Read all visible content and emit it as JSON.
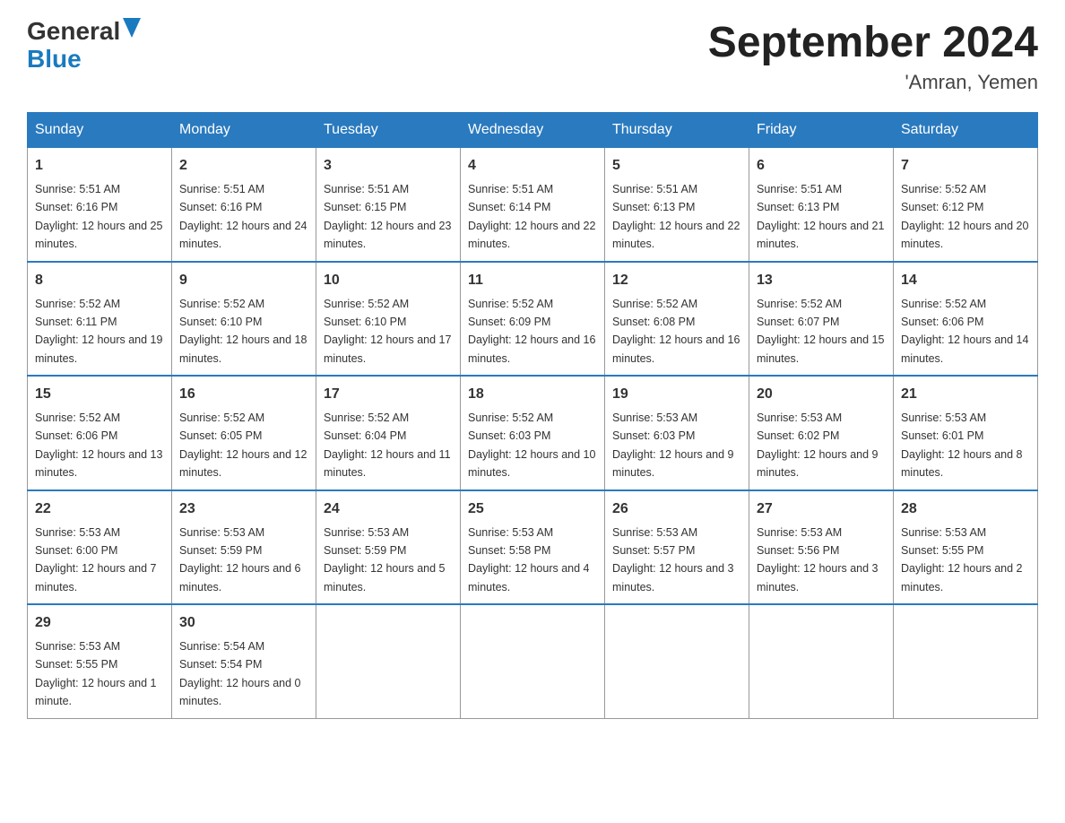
{
  "header": {
    "logo_general": "General",
    "logo_blue": "Blue",
    "month_title": "September 2024",
    "location": "'Amran, Yemen"
  },
  "days_of_week": [
    "Sunday",
    "Monday",
    "Tuesday",
    "Wednesday",
    "Thursday",
    "Friday",
    "Saturday"
  ],
  "weeks": [
    [
      {
        "day": "1",
        "sunrise": "Sunrise: 5:51 AM",
        "sunset": "Sunset: 6:16 PM",
        "daylight": "Daylight: 12 hours and 25 minutes."
      },
      {
        "day": "2",
        "sunrise": "Sunrise: 5:51 AM",
        "sunset": "Sunset: 6:16 PM",
        "daylight": "Daylight: 12 hours and 24 minutes."
      },
      {
        "day": "3",
        "sunrise": "Sunrise: 5:51 AM",
        "sunset": "Sunset: 6:15 PM",
        "daylight": "Daylight: 12 hours and 23 minutes."
      },
      {
        "day": "4",
        "sunrise": "Sunrise: 5:51 AM",
        "sunset": "Sunset: 6:14 PM",
        "daylight": "Daylight: 12 hours and 22 minutes."
      },
      {
        "day": "5",
        "sunrise": "Sunrise: 5:51 AM",
        "sunset": "Sunset: 6:13 PM",
        "daylight": "Daylight: 12 hours and 22 minutes."
      },
      {
        "day": "6",
        "sunrise": "Sunrise: 5:51 AM",
        "sunset": "Sunset: 6:13 PM",
        "daylight": "Daylight: 12 hours and 21 minutes."
      },
      {
        "day": "7",
        "sunrise": "Sunrise: 5:52 AM",
        "sunset": "Sunset: 6:12 PM",
        "daylight": "Daylight: 12 hours and 20 minutes."
      }
    ],
    [
      {
        "day": "8",
        "sunrise": "Sunrise: 5:52 AM",
        "sunset": "Sunset: 6:11 PM",
        "daylight": "Daylight: 12 hours and 19 minutes."
      },
      {
        "day": "9",
        "sunrise": "Sunrise: 5:52 AM",
        "sunset": "Sunset: 6:10 PM",
        "daylight": "Daylight: 12 hours and 18 minutes."
      },
      {
        "day": "10",
        "sunrise": "Sunrise: 5:52 AM",
        "sunset": "Sunset: 6:10 PM",
        "daylight": "Daylight: 12 hours and 17 minutes."
      },
      {
        "day": "11",
        "sunrise": "Sunrise: 5:52 AM",
        "sunset": "Sunset: 6:09 PM",
        "daylight": "Daylight: 12 hours and 16 minutes."
      },
      {
        "day": "12",
        "sunrise": "Sunrise: 5:52 AM",
        "sunset": "Sunset: 6:08 PM",
        "daylight": "Daylight: 12 hours and 16 minutes."
      },
      {
        "day": "13",
        "sunrise": "Sunrise: 5:52 AM",
        "sunset": "Sunset: 6:07 PM",
        "daylight": "Daylight: 12 hours and 15 minutes."
      },
      {
        "day": "14",
        "sunrise": "Sunrise: 5:52 AM",
        "sunset": "Sunset: 6:06 PM",
        "daylight": "Daylight: 12 hours and 14 minutes."
      }
    ],
    [
      {
        "day": "15",
        "sunrise": "Sunrise: 5:52 AM",
        "sunset": "Sunset: 6:06 PM",
        "daylight": "Daylight: 12 hours and 13 minutes."
      },
      {
        "day": "16",
        "sunrise": "Sunrise: 5:52 AM",
        "sunset": "Sunset: 6:05 PM",
        "daylight": "Daylight: 12 hours and 12 minutes."
      },
      {
        "day": "17",
        "sunrise": "Sunrise: 5:52 AM",
        "sunset": "Sunset: 6:04 PM",
        "daylight": "Daylight: 12 hours and 11 minutes."
      },
      {
        "day": "18",
        "sunrise": "Sunrise: 5:52 AM",
        "sunset": "Sunset: 6:03 PM",
        "daylight": "Daylight: 12 hours and 10 minutes."
      },
      {
        "day": "19",
        "sunrise": "Sunrise: 5:53 AM",
        "sunset": "Sunset: 6:03 PM",
        "daylight": "Daylight: 12 hours and 9 minutes."
      },
      {
        "day": "20",
        "sunrise": "Sunrise: 5:53 AM",
        "sunset": "Sunset: 6:02 PM",
        "daylight": "Daylight: 12 hours and 9 minutes."
      },
      {
        "day": "21",
        "sunrise": "Sunrise: 5:53 AM",
        "sunset": "Sunset: 6:01 PM",
        "daylight": "Daylight: 12 hours and 8 minutes."
      }
    ],
    [
      {
        "day": "22",
        "sunrise": "Sunrise: 5:53 AM",
        "sunset": "Sunset: 6:00 PM",
        "daylight": "Daylight: 12 hours and 7 minutes."
      },
      {
        "day": "23",
        "sunrise": "Sunrise: 5:53 AM",
        "sunset": "Sunset: 5:59 PM",
        "daylight": "Daylight: 12 hours and 6 minutes."
      },
      {
        "day": "24",
        "sunrise": "Sunrise: 5:53 AM",
        "sunset": "Sunset: 5:59 PM",
        "daylight": "Daylight: 12 hours and 5 minutes."
      },
      {
        "day": "25",
        "sunrise": "Sunrise: 5:53 AM",
        "sunset": "Sunset: 5:58 PM",
        "daylight": "Daylight: 12 hours and 4 minutes."
      },
      {
        "day": "26",
        "sunrise": "Sunrise: 5:53 AM",
        "sunset": "Sunset: 5:57 PM",
        "daylight": "Daylight: 12 hours and 3 minutes."
      },
      {
        "day": "27",
        "sunrise": "Sunrise: 5:53 AM",
        "sunset": "Sunset: 5:56 PM",
        "daylight": "Daylight: 12 hours and 3 minutes."
      },
      {
        "day": "28",
        "sunrise": "Sunrise: 5:53 AM",
        "sunset": "Sunset: 5:55 PM",
        "daylight": "Daylight: 12 hours and 2 minutes."
      }
    ],
    [
      {
        "day": "29",
        "sunrise": "Sunrise: 5:53 AM",
        "sunset": "Sunset: 5:55 PM",
        "daylight": "Daylight: 12 hours and 1 minute."
      },
      {
        "day": "30",
        "sunrise": "Sunrise: 5:54 AM",
        "sunset": "Sunset: 5:54 PM",
        "daylight": "Daylight: 12 hours and 0 minutes."
      },
      null,
      null,
      null,
      null,
      null
    ]
  ]
}
